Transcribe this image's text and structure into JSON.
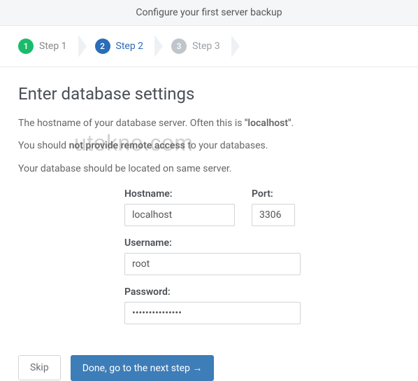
{
  "header": {
    "title": "Configure your first server backup"
  },
  "steps": [
    {
      "num": "1",
      "label": "Step 1"
    },
    {
      "num": "2",
      "label": "Step 2"
    },
    {
      "num": "3",
      "label": "Step 3"
    }
  ],
  "page": {
    "title": "Enter database settings",
    "desc1_prefix": "The hostname of your database server. Often this is ",
    "desc1_strong": "\"localhost\"",
    "desc1_suffix": ".",
    "desc2_prefix": "You should ",
    "desc2_strong": "not provide remote access",
    "desc2_suffix": " to your databases.",
    "desc3": "Your database should be located on same server."
  },
  "form": {
    "hostname": {
      "label": "Hostname:",
      "value": "localhost"
    },
    "port": {
      "label": "Port:",
      "value": "3306"
    },
    "username": {
      "label": "Username:",
      "value": "root"
    },
    "password": {
      "label": "Password:",
      "value": "•••••••••••••••"
    }
  },
  "buttons": {
    "skip": "Skip",
    "next": "Done, go to the next step →"
  },
  "watermark": "utekno.com"
}
